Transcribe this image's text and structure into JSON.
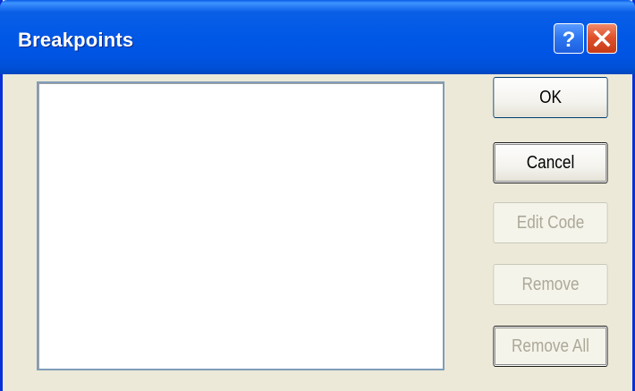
{
  "window": {
    "title": "Breakpoints"
  },
  "titlebar_buttons": {
    "help": {
      "icon": "help-icon",
      "glyph": "?"
    },
    "close": {
      "icon": "close-icon"
    }
  },
  "breakpoint_list": {
    "items": []
  },
  "buttons": {
    "ok": {
      "label": "OK",
      "enabled": true
    },
    "cancel": {
      "label": "Cancel",
      "enabled": true
    },
    "edit_code": {
      "label": "Edit Code",
      "enabled": false
    },
    "remove": {
      "label": "Remove",
      "enabled": false
    },
    "remove_all": {
      "label": "Remove All",
      "enabled": false
    }
  },
  "colors": {
    "titlebar": "#0054e3",
    "dialog_background": "#ece9d8",
    "close_button": "#e0522c",
    "disabled_text": "#aca899"
  }
}
